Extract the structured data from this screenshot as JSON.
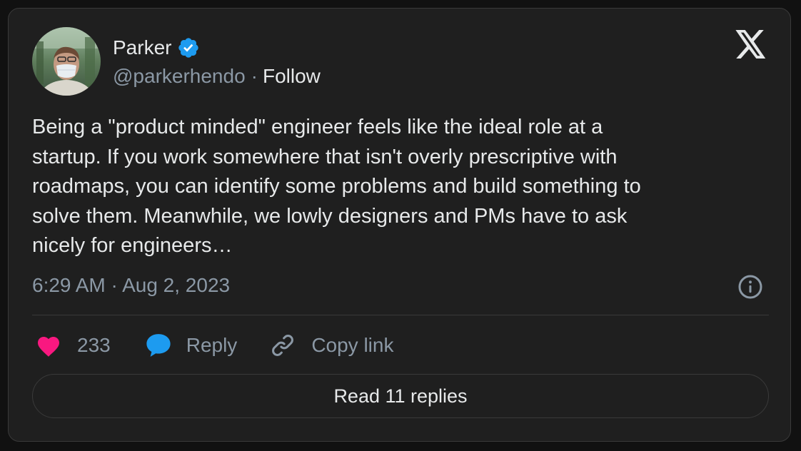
{
  "author": {
    "name": "Parker",
    "handle": "@parkerhendo",
    "separator": "·",
    "follow_label": "Follow",
    "verified": true
  },
  "tweet": {
    "text": "Being a \"product minded\" engineer feels like the ideal role at a\nstartup. If you work somewhere that isn't overly prescriptive with\nroadmaps, you can identify some problems and build something to\nsolve them. Meanwhile, we lowly designers and PMs have to ask\nnicely for engineers…",
    "timestamp": "6:29 AM · Aug 2, 2023"
  },
  "actions": {
    "likes_count": "233",
    "reply_label": "Reply",
    "copy_link_label": "Copy link"
  },
  "read_replies_label": "Read 11 replies",
  "icons": {
    "logo": "x-logo-icon",
    "verified": "verified-badge-icon",
    "info": "info-icon",
    "like": "heart-icon",
    "reply": "chat-bubble-icon",
    "copy_link": "link-icon"
  },
  "colors": {
    "background": "#1f1f1f",
    "text_primary": "#e7e9ea",
    "text_secondary": "#8b98a5",
    "verified_blue": "#1d9bf0",
    "heart_pink": "#f91880",
    "reply_blue": "#1d9bf0",
    "border": "#3a3a3a"
  }
}
